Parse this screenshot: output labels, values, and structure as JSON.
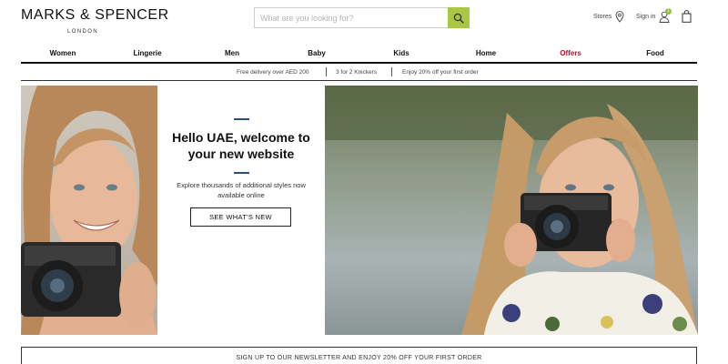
{
  "header": {
    "logo_text": "MARKS & SPENCER",
    "logo_subtext": "LONDON",
    "search_placeholder": "What are you looking for?",
    "stores_label": "Stores",
    "signin_label": "Sign in",
    "signin_badge": "1"
  },
  "nav": {
    "items": [
      {
        "label": "Women"
      },
      {
        "label": "Lingerie"
      },
      {
        "label": "Men"
      },
      {
        "label": "Baby"
      },
      {
        "label": "Kids"
      },
      {
        "label": "Home"
      },
      {
        "label": "Offers"
      },
      {
        "label": "Food"
      }
    ]
  },
  "promo": {
    "items": [
      "Free delivery over AED 200",
      "3 for 2 Knickers",
      "Enjoy 20% off your first order"
    ]
  },
  "hero": {
    "title": "Hello UAE, welcome to your new website",
    "subtitle": "Explore thousands of additional styles now available online",
    "cta_label": "SEE WHAT'S NEW"
  },
  "newsletter": {
    "text": "SIGN UP TO OUR NEWSLETTER AND ENJOY 20% OFF YOUR FIRST ORDER"
  },
  "colors": {
    "search_button": "#a9c742",
    "offers": "#b5132a",
    "accent_bar": "#2f4f7a",
    "badge": "#8fc23f"
  }
}
